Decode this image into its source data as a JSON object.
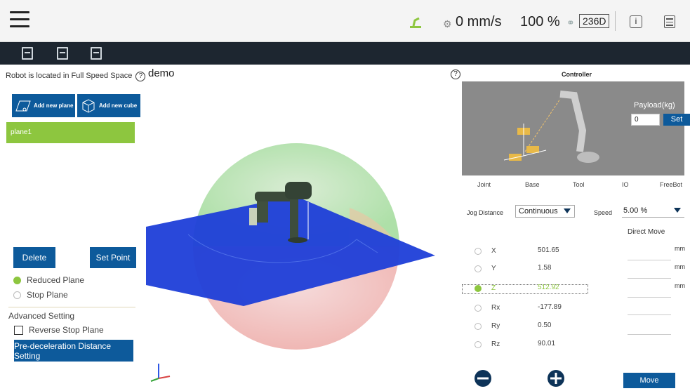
{
  "topbar": {
    "speed": "0 mm/s",
    "percent": "100 %",
    "code": "236D",
    "icons": [
      "menu-icon",
      "robot-arm-status-icon",
      "speed-icon",
      "link-icon",
      "info-icon",
      "document-icon"
    ]
  },
  "toolbar": {
    "icons": [
      "new-file-icon",
      "save-file-icon",
      "export-file-icon"
    ]
  },
  "left_panel": {
    "status_text": "Robot is located in Full Speed Space",
    "add_plane": "Add new plane",
    "add_cube": "Add new cube",
    "items": [
      "plane1"
    ],
    "delete_label": "Delete",
    "set_point_label": "Set Point",
    "plane_options": [
      {
        "label": "Reduced Plane",
        "selected": true
      },
      {
        "label": "Stop Plane",
        "selected": false
      }
    ],
    "advanced_title": "Advanced Setting",
    "reverse_label": "Reverse Stop Plane",
    "predecel_label": "Pre-deceleration Distance Setting"
  },
  "viewport": {
    "title": "demo"
  },
  "controller": {
    "title": "Controller",
    "payload_label": "Payload(kg)",
    "payload_value": "0",
    "set_label": "Set",
    "tabs": [
      "Joint",
      "Base",
      "Tool",
      "IO",
      "FreeBot"
    ],
    "jog_label": "Jog Distance",
    "jog_value": "Continuous",
    "speed_label": "Speed",
    "speed_value": "5.00 %",
    "direct_move": "Direct Move",
    "unit": "mm",
    "coords": [
      {
        "name": "X",
        "value": "501.65",
        "selected": false
      },
      {
        "name": "Y",
        "value": "1.58",
        "selected": false
      },
      {
        "name": "Z",
        "value": "512.92",
        "selected": true
      },
      {
        "name": "Rx",
        "value": "-177.89",
        "selected": false
      },
      {
        "name": "Ry",
        "value": "0.50",
        "selected": false
      },
      {
        "name": "Rz",
        "value": "90.01",
        "selected": false
      }
    ],
    "move_label": "Move",
    "colors": {
      "accent": "#0d5a9b",
      "selected": "#8dc63f",
      "dark": "#0d3358"
    }
  }
}
